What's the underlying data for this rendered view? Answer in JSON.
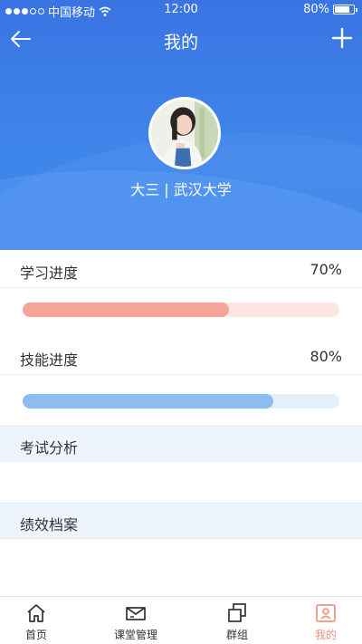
{
  "status_bar": {
    "carrier": "中国移动",
    "time": "12:00",
    "battery": "80%",
    "battery_level": 0.8
  },
  "nav": {
    "title": "我的",
    "back_icon": "arrow-left-icon",
    "add_icon": "plus-icon"
  },
  "profile": {
    "grade": "大三",
    "separator": "|",
    "school": "武汉大学"
  },
  "progress": [
    {
      "label": "学习进度",
      "value_text": "70%",
      "fill_fraction": 0.65,
      "fill_color": "#f5a497",
      "track_color": "#fde6e2"
    },
    {
      "label": "技能进度",
      "value_text": "80%",
      "fill_fraction": 0.79,
      "fill_color": "#8bbdf0",
      "track_color": "#e3effb"
    }
  ],
  "sections": [
    {
      "label": "考试分析"
    },
    {
      "label": "绩效档案"
    }
  ],
  "tabbar": {
    "items": [
      {
        "label": "首页",
        "icon": "home-icon"
      },
      {
        "label": "课堂管理",
        "icon": "envelope-icon"
      },
      {
        "label": "群组",
        "icon": "layers-icon"
      },
      {
        "label": "我的",
        "icon": "profile-card-icon",
        "active": true
      }
    ],
    "active_color": "#e9967a"
  },
  "colors": {
    "header_blue": "#3b7fe8",
    "section_bg": "#eef4fd"
  }
}
